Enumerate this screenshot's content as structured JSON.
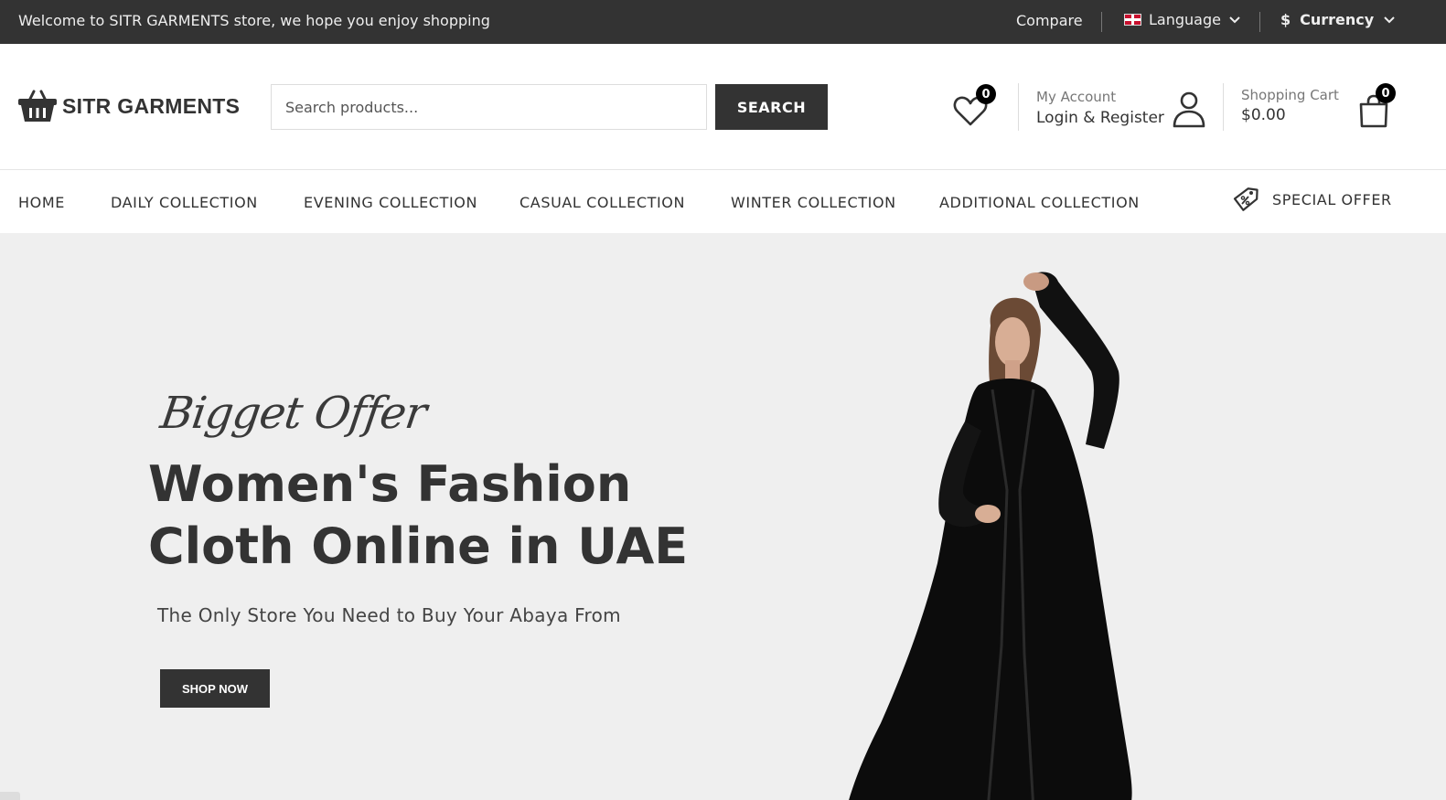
{
  "topbar": {
    "welcome": "Welcome to SITR GARMENTS store, we hope you enjoy shopping",
    "compare": "Compare",
    "language": "Language",
    "currency_symbol": "$",
    "currency": "Currency"
  },
  "header": {
    "logo_text": "SITR GARMENTS",
    "search_placeholder": "Search products...",
    "search_button": "SEARCH",
    "wishlist_count": "0",
    "account_label": "My Account",
    "account_action": "Login & Register",
    "cart_label": "Shopping Cart",
    "cart_total": "$0.00",
    "cart_count": "0"
  },
  "nav": {
    "items": [
      {
        "label": "HOME"
      },
      {
        "label": "DAILY COLLECTION"
      },
      {
        "label": "EVENING COLLECTION"
      },
      {
        "label": "CASUAL COLLECTION"
      },
      {
        "label": "WINTER COLLECTION"
      },
      {
        "label": "ADDITIONAL COLLECTION"
      }
    ],
    "special_offer": "SPECIAL OFFER"
  },
  "hero": {
    "script_text": "Bigget Offer",
    "headline": "Women's Fashion Cloth Online in UAE",
    "subtitle": "The Only Store You Need to Buy Your Abaya From",
    "cta": "SHOP NOW"
  },
  "colors": {
    "topbar_bg": "#333333",
    "hero_bg": "#efefef",
    "button_bg": "#333333",
    "badge_bg": "#000000"
  },
  "icons": [
    "flag-icon",
    "chevron-down-icon",
    "basket-logo-icon",
    "heart-icon",
    "user-icon",
    "shopping-bag-icon",
    "discount-tag-icon"
  ]
}
